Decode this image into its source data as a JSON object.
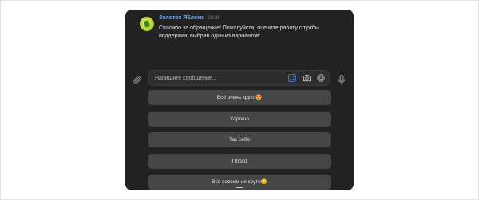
{
  "message": {
    "sender": "Золотое Яблоко",
    "time": "20:30",
    "text": "Спасибо за обращение! Пожалуйста, оцените работу службы поддержки, выбрав один из вариантов:"
  },
  "composer": {
    "placeholder": "Напишите сообщение..."
  },
  "quick_replies": [
    "Всё очень круто😍",
    "Хорошо",
    "Так себе",
    "Плохо",
    "Всё совсем не круто😔"
  ],
  "colors": {
    "window_bg": "#222222",
    "button_bg": "#454647",
    "accent_blue": "#71aaeb",
    "keyboard_icon": "#4a7dd6"
  },
  "icons": [
    "paperclip-icon",
    "keyboard-icon",
    "camera-icon",
    "emoji-icon",
    "microphone-icon"
  ]
}
